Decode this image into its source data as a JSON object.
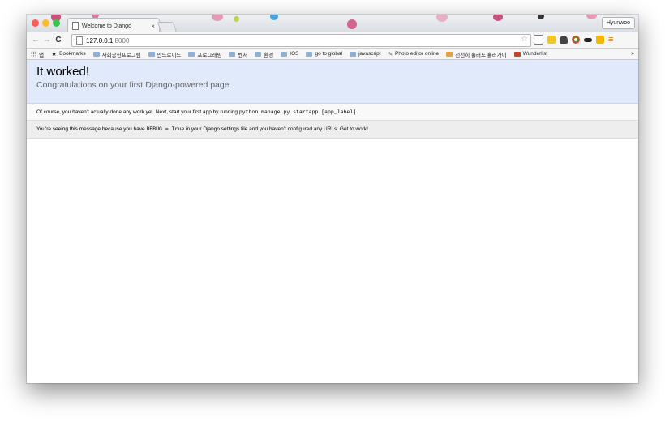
{
  "browser": {
    "tab_title": "Welcome to Django",
    "tab_close": "×",
    "profile_name": "Hyunwoo",
    "url_host": "127.0.0.1",
    "url_port": ":8000",
    "nav": {
      "back": "←",
      "forward": "→",
      "reload": "C"
    }
  },
  "bookmarks": {
    "apps_label": "앱",
    "items": [
      "Bookmarks",
      "사회공헌프로그램",
      "안드로이드",
      "프로그래밍",
      "벤처",
      "환경",
      "IOS",
      "go to global",
      "javascript",
      "Photo editor online",
      "천천히 흘러도 흘러가이",
      "Wunderlist"
    ],
    "more": "»"
  },
  "page": {
    "heading": "It worked!",
    "subheading": "Congratulations on your first Django-powered page.",
    "instructions_prefix": "Of course, you haven't actually done any work yet. Next, start your first app by running ",
    "instructions_code": "python manage.py startapp [app_label]",
    "instructions_suffix": ".",
    "explanation_prefix": "You're seeing this message because you have ",
    "explanation_code": "DEBUG = True",
    "explanation_suffix": " in your Django settings file and you haven't configured any URLs. Get to work!"
  },
  "colors": {
    "summary_bg": "#e1eafa",
    "menu_accent": "#e07b00"
  }
}
